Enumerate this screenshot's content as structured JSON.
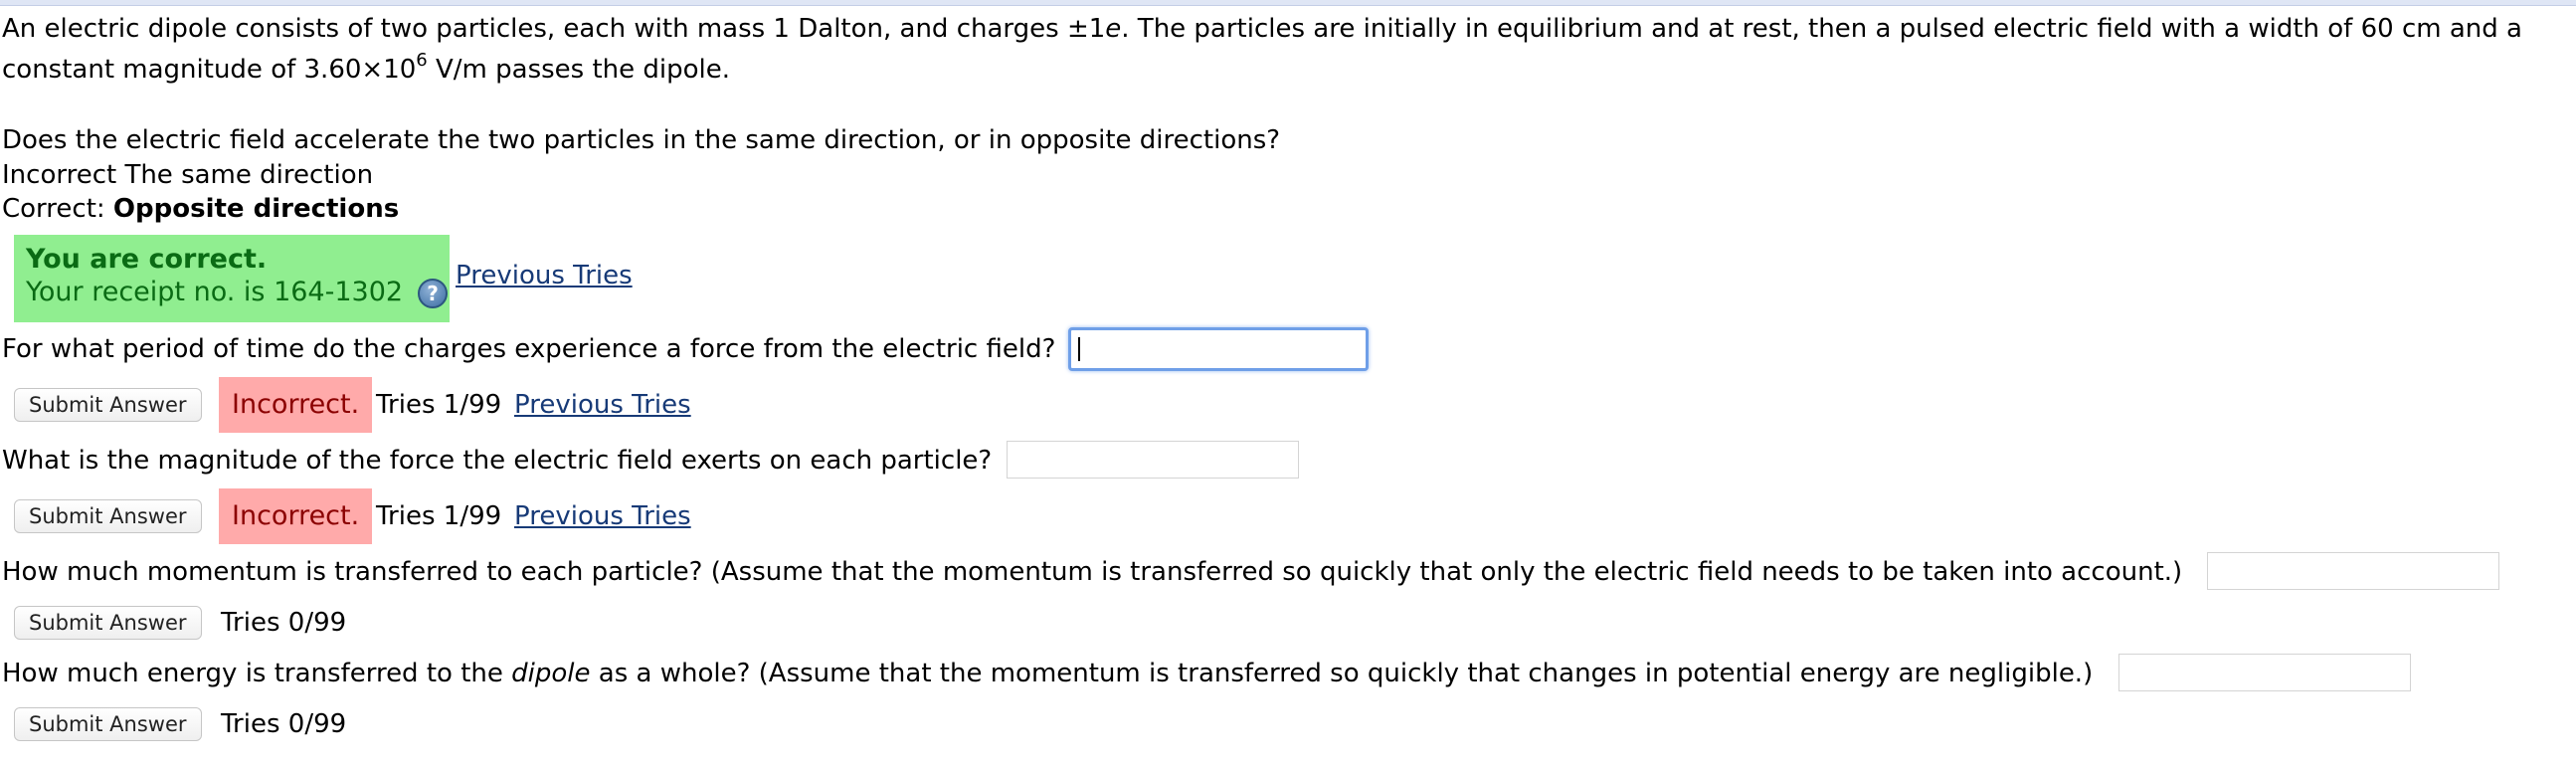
{
  "intro": {
    "line1_a": "An electric dipole consists of two particles, each with mass 1 Dalton, and charges ±1",
    "line1_e": "e",
    "line1_b": ". The particles are initially in equilibrium and at rest, then a pulsed electric field with a width of 60 cm and a",
    "line2_a": "constant magnitude of 3.60×10",
    "line2_exp": "6",
    "line2_b": " V/m passes the dipole."
  },
  "q1": {
    "prompt": "Does the electric field accelerate the two particles in the same direction, or in opposite directions?",
    "incorrect_line": "Incorrect The same direction",
    "correct_label": "Correct: ",
    "correct_answer": "Opposite directions",
    "status_title": "You are correct.",
    "receipt": "Your receipt no. is 164-1302",
    "help_glyph": "?",
    "previous_tries": "Previous Tries"
  },
  "q2": {
    "prompt": "For what period of time do the charges experience a force from the electric field?",
    "input_value": "",
    "submit": "Submit Answer",
    "status": "Incorrect.",
    "tries": "Tries 1/99",
    "previous_tries": "Previous Tries"
  },
  "q3": {
    "prompt": "What is the magnitude of the force the electric field exerts on each particle?",
    "input_value": "",
    "submit": "Submit Answer",
    "status": "Incorrect.",
    "tries": "Tries 1/99",
    "previous_tries": "Previous Tries"
  },
  "q4": {
    "prompt": "How much momentum is transferred to each particle? (Assume that the momentum is transferred so quickly that only the electric field needs to be taken into account.)",
    "input_value": "",
    "submit": "Submit Answer",
    "tries": "Tries 0/99"
  },
  "q5": {
    "prompt_a": "How much energy is transferred to the ",
    "prompt_em": "dipole",
    "prompt_b": " as a whole? (Assume that the momentum is transferred so quickly that changes in potential energy are negligible.)",
    "input_value": "",
    "submit": "Submit Answer",
    "tries": "Tries 0/99"
  },
  "colors": {
    "correct_bg": "#90ee90",
    "incorrect_bg": "#ffaaaa",
    "link": "#173a77"
  }
}
